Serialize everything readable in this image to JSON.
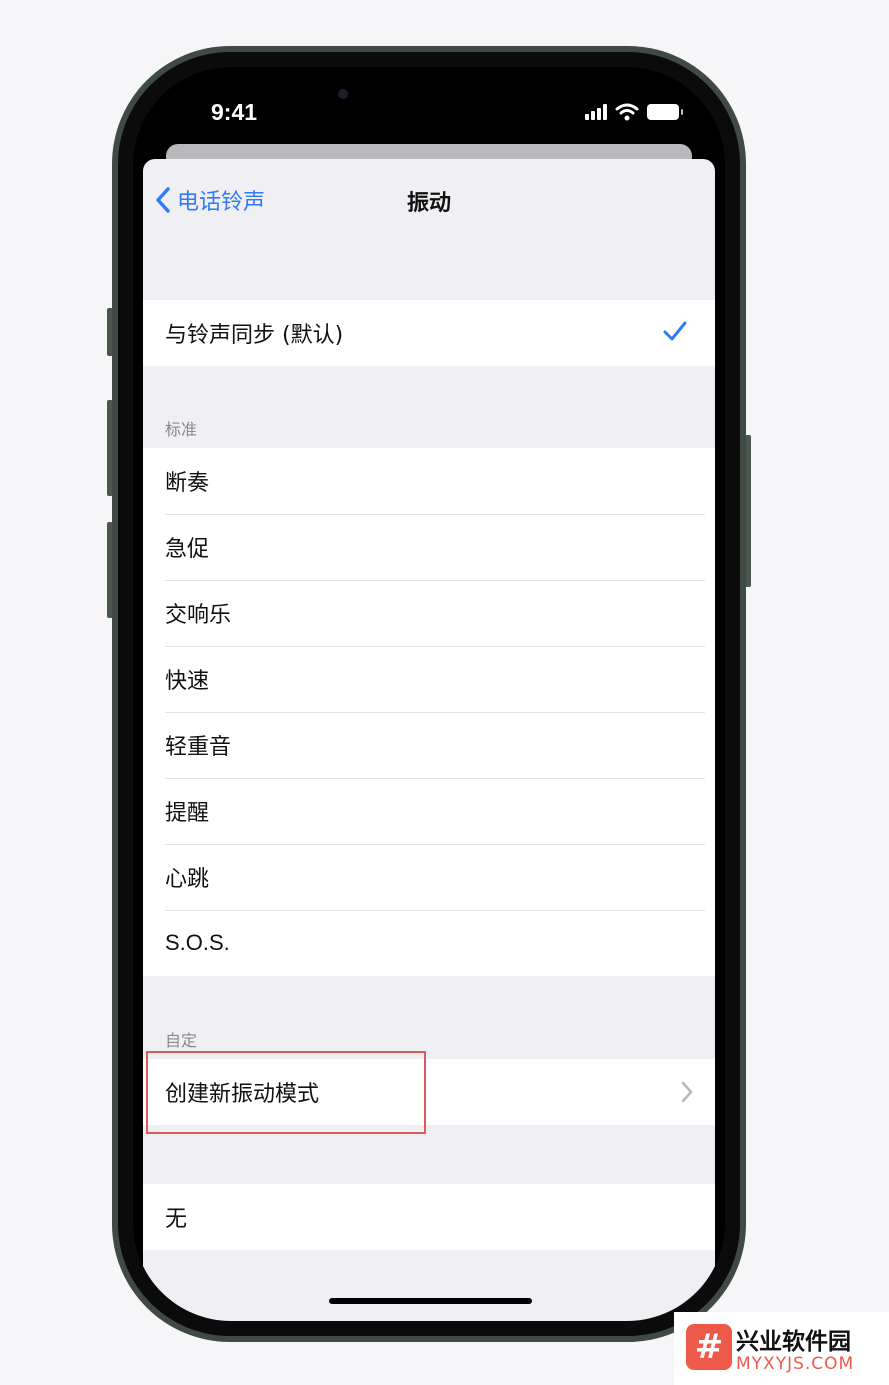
{
  "status_bar": {
    "time": "9:41",
    "icons": [
      "cellular-signal-icon",
      "wifi-icon",
      "battery-icon"
    ]
  },
  "nav": {
    "back_label": "电话铃声",
    "title": "振动"
  },
  "sync_option": {
    "label": "与铃声同步 (默认)",
    "selected": true
  },
  "standard": {
    "header": "标准",
    "items": [
      {
        "label": "断奏"
      },
      {
        "label": "急促"
      },
      {
        "label": "交响乐"
      },
      {
        "label": "快速"
      },
      {
        "label": "轻重音"
      },
      {
        "label": "提醒"
      },
      {
        "label": "心跳"
      },
      {
        "label": "S.O.S."
      }
    ]
  },
  "custom": {
    "header": "自定",
    "create_label": "创建新振动模式"
  },
  "none_option": {
    "label": "无"
  },
  "watermark": {
    "logo_glyph": "#",
    "title": "兴业软件园",
    "url": "MYXYJS.COM"
  },
  "colors": {
    "accent": "#2f7bf5",
    "highlight_box": "#e05a5a",
    "watermark_brand": "#ee5a4a"
  }
}
